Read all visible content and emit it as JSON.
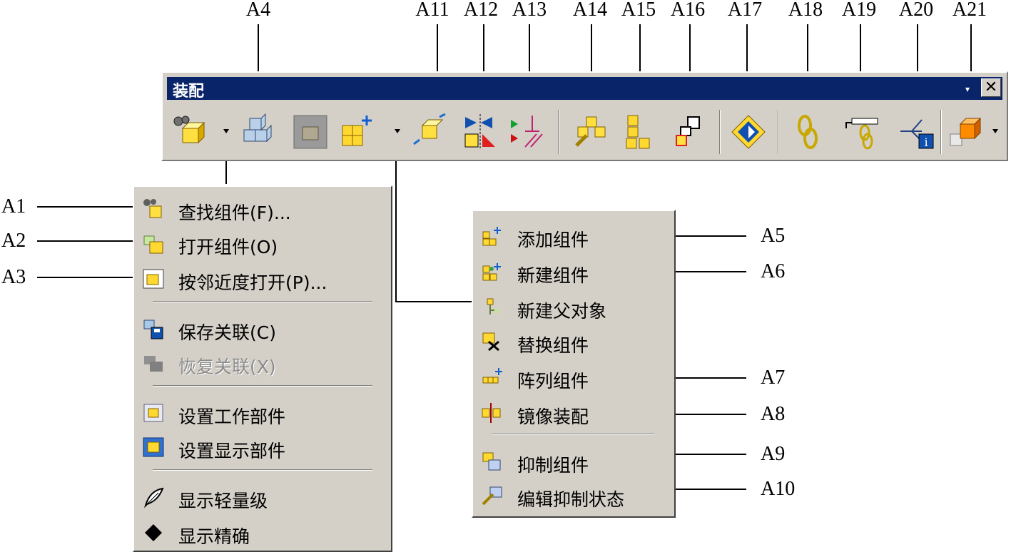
{
  "toolbar": {
    "title": "装配",
    "close_glyph": "✕",
    "menu_arrow_glyph": "▾"
  },
  "labels_top": [
    "A4",
    "A11",
    "A12",
    "A13",
    "A14",
    "A15",
    "A16",
    "A17",
    "A18",
    "A19",
    "A20",
    "A21"
  ],
  "labels_left": [
    "A1",
    "A2",
    "A3"
  ],
  "labels_right": [
    "A5",
    "A6",
    "A7",
    "A8",
    "A9",
    "A10"
  ],
  "menu_left": {
    "items": [
      {
        "label": "查找组件(F)...",
        "icon": "find-component-icon"
      },
      {
        "label": "打开组件(O)",
        "icon": "open-component-icon"
      },
      {
        "label": "按邻近度打开(P)...",
        "icon": "open-by-proximity-icon"
      },
      {
        "label": "保存关联(C)",
        "icon": "save-association-icon"
      },
      {
        "label": "恢复关联(X)",
        "icon": "restore-association-icon"
      },
      {
        "label": "设置工作部件",
        "icon": "set-work-part-icon"
      },
      {
        "label": "设置显示部件",
        "icon": "set-display-part-icon"
      },
      {
        "label": "显示轻量级",
        "icon": "feather-icon"
      },
      {
        "label": "显示精确",
        "icon": "diamond-icon"
      }
    ]
  },
  "menu_right": {
    "items": [
      {
        "label": "添加组件",
        "icon": "add-component-icon"
      },
      {
        "label": "新建组件",
        "icon": "new-component-icon"
      },
      {
        "label": "新建父对象",
        "icon": "new-parent-icon"
      },
      {
        "label": "替换组件",
        "icon": "replace-component-icon"
      },
      {
        "label": "阵列组件",
        "icon": "array-component-icon"
      },
      {
        "label": "镜像装配",
        "icon": "mirror-assembly-icon"
      },
      {
        "label": "抑制组件",
        "icon": "suppress-component-icon"
      },
      {
        "label": "编辑抑制状态",
        "icon": "edit-suppression-icon"
      }
    ]
  }
}
